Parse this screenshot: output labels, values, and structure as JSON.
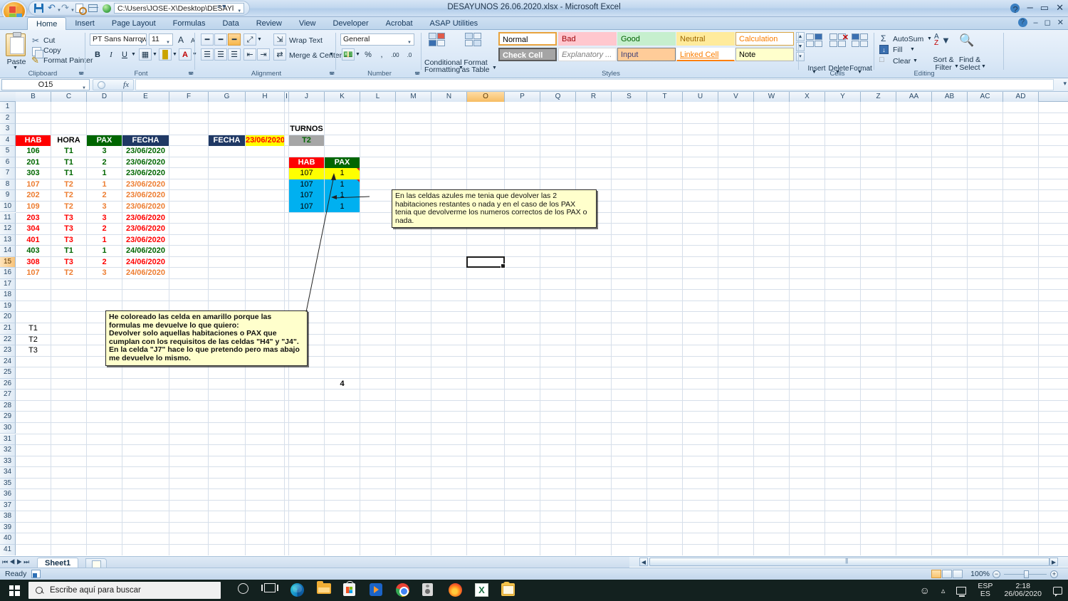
{
  "titlebar": {
    "document_title": "DESAYUNOS 26.06.2020.xlsx  -  Microsoft Excel",
    "path_value": "C:\\Users\\JOSE-X\\Desktop\\DESAYl",
    "qat": [
      {
        "name": "save",
        "icon": "save-icon"
      },
      {
        "name": "undo",
        "icon": "undo-icon"
      },
      {
        "name": "redo",
        "icon": "redo-icon"
      },
      {
        "name": "print-preview",
        "icon": "print-preview-icon"
      },
      {
        "name": "form",
        "icon": "form-icon"
      },
      {
        "name": "macro",
        "icon": "green-ball-icon"
      }
    ],
    "window_controls": {
      "minimize": "–",
      "maximize": "▭",
      "close": "✕"
    },
    "help_label": "?"
  },
  "ribbon": {
    "tabs": [
      {
        "label": "Home",
        "active": true
      },
      {
        "label": "Insert",
        "active": false
      },
      {
        "label": "Page Layout",
        "active": false
      },
      {
        "label": "Formulas",
        "active": false
      },
      {
        "label": "Data",
        "active": false
      },
      {
        "label": "Review",
        "active": false
      },
      {
        "label": "View",
        "active": false
      },
      {
        "label": "Developer",
        "active": false
      },
      {
        "label": "Acrobat",
        "active": false
      },
      {
        "label": "ASAP Utilities",
        "active": false
      }
    ],
    "clipboard": {
      "group_label": "Clipboard",
      "paste": "Paste",
      "cut": "Cut",
      "copy": "Copy",
      "format_painter": "Format Painter"
    },
    "font": {
      "group_label": "Font",
      "font_name": "PT Sans Narrow",
      "font_size": "11",
      "grow": "A",
      "shrink": "A",
      "bold": "B",
      "italic": "I",
      "underline": "U"
    },
    "alignment": {
      "group_label": "Alignment",
      "wrap_text": "Wrap Text",
      "merge_center": "Merge & Center"
    },
    "number": {
      "group_label": "Number",
      "format": "General",
      "percent": "%",
      "comma": ",",
      "increase_decimal": ".00",
      "decrease_decimal": ".0"
    },
    "styles": {
      "group_label": "Styles",
      "conditional_formatting_line1": "Conditional",
      "conditional_formatting_line2": "Formatting",
      "format_as_table_line1": "Format",
      "format_as_table_line2": "as Table",
      "gallery": [
        {
          "label": "Normal",
          "bg": "#ffffff",
          "fg": "#000000",
          "border": "#e8a33d"
        },
        {
          "label": "Bad",
          "bg": "#ffc7ce",
          "fg": "#9c0006",
          "border": "#ffc7ce"
        },
        {
          "label": "Good",
          "bg": "#c6efce",
          "fg": "#006100",
          "border": "#c6efce"
        },
        {
          "label": "Neutral",
          "bg": "#ffeb9c",
          "fg": "#9c6500",
          "border": "#ffeb9c"
        },
        {
          "label": "Calculation",
          "bg": "#ffffff",
          "fg": "#fa7d00",
          "border": "#d9a441"
        },
        {
          "label": "Check Cell",
          "bg": "#a5a5a5",
          "fg": "#ffffff",
          "border": "#5b5b5b"
        },
        {
          "label": "Explanatory ...",
          "bg": "#ffffff",
          "fg": "#7f7f7f",
          "border": "#d9d9d9"
        },
        {
          "label": "Input",
          "bg": "#ffcc99",
          "fg": "#3f3f76",
          "border": "#7f7f7f"
        },
        {
          "label": "Linked Cell",
          "bg": "#ffffff",
          "fg": "#fa7d00",
          "border": "#ff8001"
        },
        {
          "label": "Note",
          "bg": "#ffffcc",
          "fg": "#000000",
          "border": "#b2b2b2"
        }
      ]
    },
    "cells": {
      "group_label": "Cells",
      "insert": "Insert",
      "delete": "Delete",
      "format": "Format"
    },
    "editing": {
      "group_label": "Editing",
      "autosum": "AutoSum",
      "fill": "Fill",
      "clear": "Clear",
      "sort_filter_line1": "Sort &",
      "sort_filter_line2": "Filter",
      "find_select_line1": "Find &",
      "find_select_line2": "Select"
    }
  },
  "formula_bar": {
    "name_box": "O15",
    "fx_label": "fx",
    "formula_value": ""
  },
  "grid": {
    "columns": [
      "B",
      "C",
      "D",
      "E",
      "F",
      "G",
      "H",
      "I",
      "J",
      "K",
      "L",
      "M",
      "N",
      "O",
      "P",
      "Q",
      "R",
      "S",
      "T",
      "U",
      "V",
      "W",
      "X",
      "Y",
      "Z",
      "AA",
      "AB",
      "AC",
      "AD"
    ],
    "selected_column": "O",
    "selected_row": 15,
    "rows": [
      1,
      2,
      3,
      4,
      5,
      6,
      7,
      8,
      9,
      10,
      11,
      12,
      13,
      14,
      15,
      16,
      17,
      18,
      19,
      20,
      21,
      22,
      23,
      24,
      25,
      26,
      27,
      28,
      29,
      30,
      31,
      32,
      33,
      34,
      35,
      36,
      37,
      38,
      39,
      40,
      41
    ],
    "selected_cell": "O15",
    "cells": [
      {
        "ref": "B4",
        "col": "B",
        "row": 4,
        "text": "HAB",
        "bg": "#ff0000",
        "fg": "#ffffff",
        "bold": true,
        "align": "center"
      },
      {
        "ref": "C4",
        "col": "C",
        "row": 4,
        "text": "HORA",
        "bg": "#ffffff",
        "fg": "#000000",
        "bold": true,
        "align": "center"
      },
      {
        "ref": "D4",
        "col": "D",
        "row": 4,
        "text": "PAX",
        "bg": "#006600",
        "fg": "#ffffff",
        "bold": true,
        "align": "center"
      },
      {
        "ref": "E4",
        "col": "E",
        "row": 4,
        "text": "FECHA",
        "bg": "#1f3864",
        "fg": "#ffffff",
        "bold": true,
        "align": "center"
      },
      {
        "ref": "B5",
        "col": "B",
        "row": 5,
        "text": "106",
        "fg": "#006600",
        "bold": true,
        "align": "center"
      },
      {
        "ref": "C5",
        "col": "C",
        "row": 5,
        "text": "T1",
        "fg": "#006600",
        "bold": true,
        "align": "center"
      },
      {
        "ref": "D5",
        "col": "D",
        "row": 5,
        "text": "3",
        "fg": "#006600",
        "bold": true,
        "align": "center"
      },
      {
        "ref": "E5",
        "col": "E",
        "row": 5,
        "text": "23/06/2020",
        "fg": "#006600",
        "bold": true,
        "align": "center"
      },
      {
        "ref": "B6",
        "col": "B",
        "row": 6,
        "text": "201",
        "fg": "#006600",
        "bold": true,
        "align": "center"
      },
      {
        "ref": "C6",
        "col": "C",
        "row": 6,
        "text": "T1",
        "fg": "#006600",
        "bold": true,
        "align": "center"
      },
      {
        "ref": "D6",
        "col": "D",
        "row": 6,
        "text": "2",
        "fg": "#006600",
        "bold": true,
        "align": "center"
      },
      {
        "ref": "E6",
        "col": "E",
        "row": 6,
        "text": "23/06/2020",
        "fg": "#006600",
        "bold": true,
        "align": "center"
      },
      {
        "ref": "B7",
        "col": "B",
        "row": 7,
        "text": "303",
        "fg": "#006600",
        "bold": true,
        "align": "center"
      },
      {
        "ref": "C7",
        "col": "C",
        "row": 7,
        "text": "T1",
        "fg": "#006600",
        "bold": true,
        "align": "center"
      },
      {
        "ref": "D7",
        "col": "D",
        "row": 7,
        "text": "1",
        "fg": "#006600",
        "bold": true,
        "align": "center"
      },
      {
        "ref": "E7",
        "col": "E",
        "row": 7,
        "text": "23/06/2020",
        "fg": "#006600",
        "bold": true,
        "align": "center"
      },
      {
        "ref": "B8",
        "col": "B",
        "row": 8,
        "text": "107",
        "fg": "#ed7d31",
        "bold": true,
        "align": "center"
      },
      {
        "ref": "C8",
        "col": "C",
        "row": 8,
        "text": "T2",
        "fg": "#ed7d31",
        "bold": true,
        "align": "center"
      },
      {
        "ref": "D8",
        "col": "D",
        "row": 8,
        "text": "1",
        "fg": "#ed7d31",
        "bold": true,
        "align": "center"
      },
      {
        "ref": "E8",
        "col": "E",
        "row": 8,
        "text": "23/06/2020",
        "fg": "#ed7d31",
        "bold": true,
        "align": "center"
      },
      {
        "ref": "B9",
        "col": "B",
        "row": 9,
        "text": "202",
        "fg": "#ed7d31",
        "bold": true,
        "align": "center"
      },
      {
        "ref": "C9",
        "col": "C",
        "row": 9,
        "text": "T2",
        "fg": "#ed7d31",
        "bold": true,
        "align": "center"
      },
      {
        "ref": "D9",
        "col": "D",
        "row": 9,
        "text": "2",
        "fg": "#ed7d31",
        "bold": true,
        "align": "center"
      },
      {
        "ref": "E9",
        "col": "E",
        "row": 9,
        "text": "23/06/2020",
        "fg": "#ed7d31",
        "bold": true,
        "align": "center"
      },
      {
        "ref": "B10",
        "col": "B",
        "row": 10,
        "text": "109",
        "fg": "#ed7d31",
        "bold": true,
        "align": "center"
      },
      {
        "ref": "C10",
        "col": "C",
        "row": 10,
        "text": "T2",
        "fg": "#ed7d31",
        "bold": true,
        "align": "center"
      },
      {
        "ref": "D10",
        "col": "D",
        "row": 10,
        "text": "3",
        "fg": "#ed7d31",
        "bold": true,
        "align": "center"
      },
      {
        "ref": "E10",
        "col": "E",
        "row": 10,
        "text": "23/06/2020",
        "fg": "#ed7d31",
        "bold": true,
        "align": "center"
      },
      {
        "ref": "B11",
        "col": "B",
        "row": 11,
        "text": "203",
        "fg": "#ff0000",
        "bold": true,
        "align": "center"
      },
      {
        "ref": "C11",
        "col": "C",
        "row": 11,
        "text": "T3",
        "fg": "#ff0000",
        "bold": true,
        "align": "center"
      },
      {
        "ref": "D11",
        "col": "D",
        "row": 11,
        "text": "3",
        "fg": "#ff0000",
        "bold": true,
        "align": "center"
      },
      {
        "ref": "E11",
        "col": "E",
        "row": 11,
        "text": "23/06/2020",
        "fg": "#ff0000",
        "bold": true,
        "align": "center"
      },
      {
        "ref": "B12",
        "col": "B",
        "row": 12,
        "text": "304",
        "fg": "#ff0000",
        "bold": true,
        "align": "center"
      },
      {
        "ref": "C12",
        "col": "C",
        "row": 12,
        "text": "T3",
        "fg": "#ff0000",
        "bold": true,
        "align": "center"
      },
      {
        "ref": "D12",
        "col": "D",
        "row": 12,
        "text": "2",
        "fg": "#ff0000",
        "bold": true,
        "align": "center"
      },
      {
        "ref": "E12",
        "col": "E",
        "row": 12,
        "text": "23/06/2020",
        "fg": "#ff0000",
        "bold": true,
        "align": "center"
      },
      {
        "ref": "B13",
        "col": "B",
        "row": 13,
        "text": "401",
        "fg": "#ff0000",
        "bold": true,
        "align": "center"
      },
      {
        "ref": "C13",
        "col": "C",
        "row": 13,
        "text": "T3",
        "fg": "#ff0000",
        "bold": true,
        "align": "center"
      },
      {
        "ref": "D13",
        "col": "D",
        "row": 13,
        "text": "1",
        "fg": "#ff0000",
        "bold": true,
        "align": "center"
      },
      {
        "ref": "E13",
        "col": "E",
        "row": 13,
        "text": "23/06/2020",
        "fg": "#ff0000",
        "bold": true,
        "align": "center"
      },
      {
        "ref": "B14",
        "col": "B",
        "row": 14,
        "text": "403",
        "fg": "#006600",
        "bold": true,
        "align": "center"
      },
      {
        "ref": "C14",
        "col": "C",
        "row": 14,
        "text": "T1",
        "fg": "#006600",
        "bold": true,
        "align": "center"
      },
      {
        "ref": "D14",
        "col": "D",
        "row": 14,
        "text": "1",
        "fg": "#006600",
        "bold": true,
        "align": "center"
      },
      {
        "ref": "E14",
        "col": "E",
        "row": 14,
        "text": "24/06/2020",
        "fg": "#006600",
        "bold": true,
        "align": "center"
      },
      {
        "ref": "B15",
        "col": "B",
        "row": 15,
        "text": "308",
        "fg": "#ff0000",
        "bold": true,
        "align": "center"
      },
      {
        "ref": "C15",
        "col": "C",
        "row": 15,
        "text": "T3",
        "fg": "#ff0000",
        "bold": true,
        "align": "center"
      },
      {
        "ref": "D15",
        "col": "D",
        "row": 15,
        "text": "2",
        "fg": "#ff0000",
        "bold": true,
        "align": "center"
      },
      {
        "ref": "E15",
        "col": "E",
        "row": 15,
        "text": "24/06/2020",
        "fg": "#ff0000",
        "bold": true,
        "align": "center"
      },
      {
        "ref": "B16",
        "col": "B",
        "row": 16,
        "text": "107",
        "fg": "#ed7d31",
        "bold": true,
        "align": "center"
      },
      {
        "ref": "C16",
        "col": "C",
        "row": 16,
        "text": "T2",
        "fg": "#ed7d31",
        "bold": true,
        "align": "center"
      },
      {
        "ref": "D16",
        "col": "D",
        "row": 16,
        "text": "3",
        "fg": "#ed7d31",
        "bold": true,
        "align": "center"
      },
      {
        "ref": "E16",
        "col": "E",
        "row": 16,
        "text": "24/06/2020",
        "fg": "#ed7d31",
        "bold": true,
        "align": "center"
      },
      {
        "ref": "G4",
        "col": "G",
        "row": 4,
        "text": "FECHA",
        "bg": "#1f3864",
        "fg": "#ffffff",
        "bold": true,
        "align": "center"
      },
      {
        "ref": "H4",
        "col": "H",
        "row": 4,
        "text": "23/06/2020",
        "bg": "#ffff00",
        "fg": "#ff0000",
        "bold": true,
        "align": "center"
      },
      {
        "ref": "J3",
        "col": "J",
        "row": 3,
        "text": "TURNOS",
        "fg": "#000000",
        "bold": true,
        "align": "center"
      },
      {
        "ref": "J4",
        "col": "J",
        "row": 4,
        "text": "T2",
        "bg": "#a6a6a6",
        "fg": "#006600",
        "bold": true,
        "align": "center"
      },
      {
        "ref": "J6",
        "col": "J",
        "row": 6,
        "text": "HAB",
        "bg": "#ff0000",
        "fg": "#ffffff",
        "bold": true,
        "align": "center"
      },
      {
        "ref": "K6",
        "col": "K",
        "row": 6,
        "text": "PAX",
        "bg": "#006600",
        "fg": "#ffffff",
        "bold": true,
        "align": "center"
      },
      {
        "ref": "J7",
        "col": "J",
        "row": 7,
        "text": "107",
        "bg": "#ffff00",
        "fg": "#000000",
        "bold": false,
        "align": "center"
      },
      {
        "ref": "K7",
        "col": "K",
        "row": 7,
        "text": "1",
        "bg": "#ffff00",
        "fg": "#000000",
        "bold": false,
        "align": "center"
      },
      {
        "ref": "J8",
        "col": "J",
        "row": 8,
        "text": "107",
        "bg": "#00b0f0",
        "fg": "#000000",
        "bold": false,
        "align": "center"
      },
      {
        "ref": "K8",
        "col": "K",
        "row": 8,
        "text": "1",
        "bg": "#00b0f0",
        "fg": "#000000",
        "bold": false,
        "align": "center"
      },
      {
        "ref": "J9",
        "col": "J",
        "row": 9,
        "text": "107",
        "bg": "#00b0f0",
        "fg": "#000000",
        "bold": false,
        "align": "center"
      },
      {
        "ref": "K9",
        "col": "K",
        "row": 9,
        "text": "1",
        "bg": "#00b0f0",
        "fg": "#000000",
        "bold": false,
        "align": "center"
      },
      {
        "ref": "J10",
        "col": "J",
        "row": 10,
        "text": "107",
        "bg": "#00b0f0",
        "fg": "#000000",
        "bold": false,
        "align": "center"
      },
      {
        "ref": "K10",
        "col": "K",
        "row": 10,
        "text": "1",
        "bg": "#00b0f0",
        "fg": "#000000",
        "bold": false,
        "align": "center"
      },
      {
        "ref": "B21",
        "col": "B",
        "row": 21,
        "text": "T1",
        "fg": "#000000",
        "bold": false,
        "align": "center"
      },
      {
        "ref": "B22",
        "col": "B",
        "row": 22,
        "text": "T2",
        "fg": "#000000",
        "bold": false,
        "align": "center"
      },
      {
        "ref": "B23",
        "col": "B",
        "row": 23,
        "text": "T3",
        "fg": "#000000",
        "bold": false,
        "align": "center"
      },
      {
        "ref": "K26",
        "col": "K",
        "row": 26,
        "text": "4",
        "fg": "#000000",
        "bold": true,
        "align": "center"
      }
    ],
    "comments": [
      {
        "name": "comment-blue-cells",
        "anchor_cell": "K8",
        "text": "En las celdas azules me tenia que devolver las 2 habitaciones restantes o nada y en el caso de los PAX tenia que devolverme los numeros correctos de los PAX o nada."
      },
      {
        "name": "comment-yellow-cell",
        "anchor_cell": "J7",
        "text": "He coloreado las celda en amarillo porque las formulas me devuelve lo que quiero:\nDevolver solo aquellas habitaciones o PAX que cumplan con los requisitos de las celdas \"H4\" y \"J4\".\nEn la celda \"J7\" hace lo que pretendo pero mas abajo me devuelve lo mismo."
      }
    ]
  },
  "sheet_tabs": {
    "nav_first": "⏮",
    "nav_prev": "◀",
    "nav_next": "▶",
    "nav_last": "⏭",
    "tabs": [
      {
        "label": "Sheet1",
        "active": true
      }
    ],
    "new_sheet_label": ""
  },
  "status_bar": {
    "status": "Ready",
    "view_normal": "normal-view",
    "view_page_layout": "page-layout-view",
    "view_page_break": "page-break-view",
    "zoom": "100%",
    "zoom_out": "−",
    "zoom_in": "+"
  },
  "taskbar": {
    "search_placeholder": "Escribe aquí para buscar",
    "icons": [
      {
        "name": "cortana-icon"
      },
      {
        "name": "task-view-icon"
      },
      {
        "name": "microsoft-edge-icon"
      },
      {
        "name": "file-explorer-icon"
      },
      {
        "name": "microsoft-store-icon"
      },
      {
        "name": "movies-tv-icon"
      },
      {
        "name": "google-chrome-icon"
      },
      {
        "name": "speaker-app-icon"
      },
      {
        "name": "mozilla-firefox-icon"
      },
      {
        "name": "microsoft-excel-icon"
      },
      {
        "name": "microsoft-outlook-icon"
      }
    ],
    "tray": {
      "language_line1": "ESP",
      "language_line2": "ES",
      "time": "2:18",
      "date": "26/06/2020"
    }
  }
}
